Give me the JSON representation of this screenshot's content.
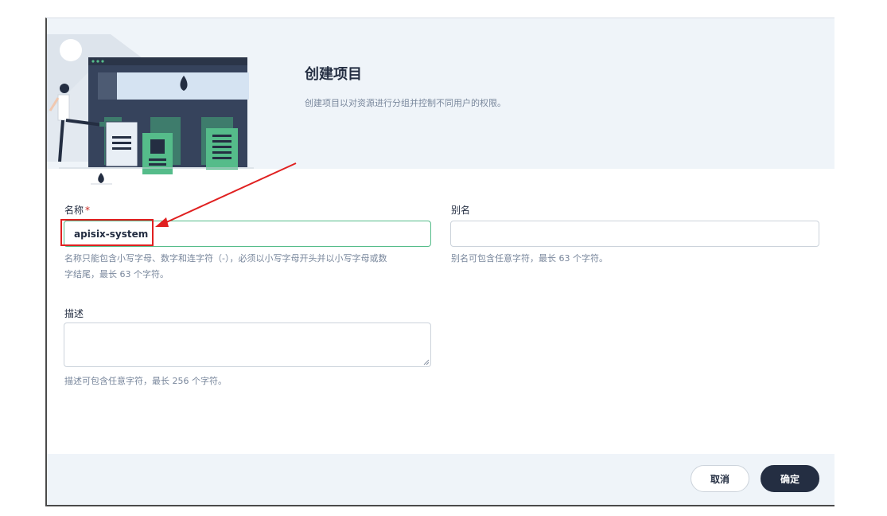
{
  "header": {
    "title": "创建项目",
    "description": "创建项目以对资源进行分组并控制不同用户的权限。"
  },
  "form": {
    "name": {
      "label": "名称",
      "required_mark": "*",
      "value": "apisix-system",
      "hint_line1": "名称只能包含小写字母、数字和连字符（-），必须以小写字母开头并以小写字母或数",
      "hint_line2": "字结尾，最长 63 个字符。"
    },
    "alias": {
      "label": "别名",
      "value": "",
      "hint": "别名可包含任意字符，最长 63 个字符。"
    },
    "description": {
      "label": "描述",
      "value": "",
      "hint": "描述可包含任意字符，最长 256 个字符。"
    }
  },
  "footer": {
    "cancel_label": "取消",
    "ok_label": "确定"
  },
  "colors": {
    "primary_dark": "#242e42",
    "accent_green": "#55bc8a",
    "annotation_red": "#e02020",
    "header_bg": "#eff4f9"
  },
  "icons": {
    "illustration": "project-illustration",
    "annotation": "red-arrow-annotation"
  }
}
